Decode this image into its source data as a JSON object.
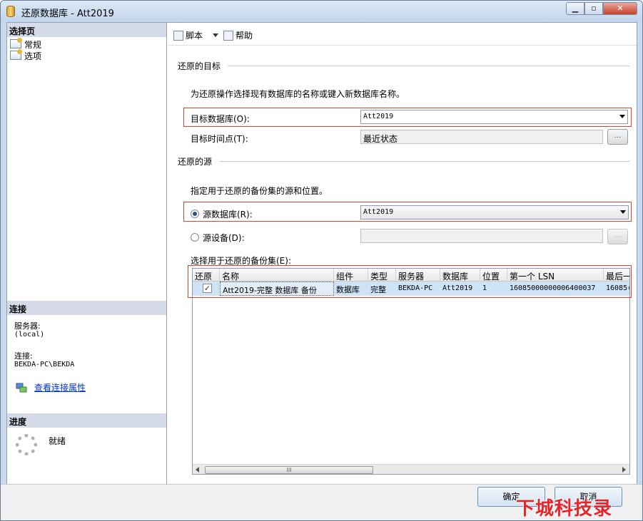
{
  "window": {
    "title": "还原数据库 - Att2019",
    "min": "▁",
    "max": "▫",
    "close": "✕"
  },
  "left": {
    "select_page": "选择页",
    "pages": [
      {
        "label": "常规"
      },
      {
        "label": "选项"
      }
    ],
    "connection_header": "连接",
    "server_label": "服务器:",
    "server_value": "(local)",
    "connection_label": "连接:",
    "connection_value": "BEKDA-PC\\BEKDA",
    "view_props_link": "查看连接属性",
    "progress_header": "进度",
    "progress_status": "就绪"
  },
  "toolbar": {
    "script": "脚本",
    "help": "帮助"
  },
  "target": {
    "group_title": "还原的目标",
    "instruction": "为还原操作选择现有数据库的名称或键入新数据库名称。",
    "db_label": "目标数据库(O):",
    "db_value": "Att2019",
    "time_label": "目标时间点(T):",
    "time_value": "最近状态",
    "ellipsis": "..."
  },
  "source": {
    "group_title": "还原的源",
    "instruction": "指定用于还原的备份集的源和位置。",
    "src_db_label": "源数据库(R):",
    "src_db_value": "Att2019",
    "src_device_label": "源设备(D):",
    "src_db_selected": true,
    "ellipsis": "...",
    "backupsets_label": "选择用于还原的备份集(E):"
  },
  "grid": {
    "columns": [
      "还原",
      "名称",
      "组件",
      "类型",
      "服务器",
      "数据库",
      "位置",
      "第一个 LSN",
      "最后一"
    ],
    "rows": [
      {
        "restore": true,
        "check": "✓",
        "name": "Att2019-完整 数据库 备份",
        "component": "数据库",
        "type": "完整",
        "server": "BEKDA-PC",
        "database": "Att2019",
        "position": "1",
        "first_lsn": "16085000000006400037",
        "last_lsn": "16085("
      }
    ],
    "scroll_grip": "III"
  },
  "footer": {
    "ok": "确定",
    "cancel": "取消"
  },
  "watermark": "下城科技录"
}
